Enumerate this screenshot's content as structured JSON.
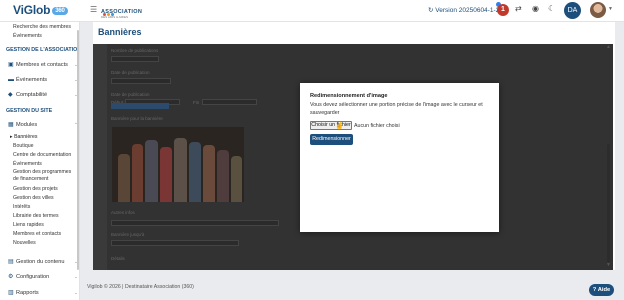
{
  "header": {
    "logo_text": "ViGlob",
    "logo_badge": "360",
    "assoc_title": "ASSOCIATION",
    "assoc_subtitle": "DES AMIS & AMIES",
    "version": "Version 20250604-1-2",
    "notification_count": "1",
    "org_initials": "DA"
  },
  "sidebar": {
    "top_items": [
      "Recherche des membres",
      "Événements"
    ],
    "section_assoc": "GESTION DE L'ASSOCIATION",
    "assoc_items": [
      {
        "label": "Membres et contacts",
        "icon": "people-icon"
      },
      {
        "label": "Événements",
        "icon": "folder-icon"
      },
      {
        "label": "Comptabilité",
        "icon": "money-icon"
      }
    ],
    "section_site": "GESTION DU SITE",
    "site_item": {
      "label": "Modules",
      "icon": "grid-icon"
    },
    "active_sub": "Bannières",
    "module_items": [
      "Boutique",
      "Centre de documentation",
      "Événements",
      "Gestion des programmes de financement",
      "Gestion des projets",
      "Gestion des villes",
      "Intérêts",
      "Librairie des termes",
      "Liens rapides",
      "Membres et contacts",
      "Nouvelles"
    ],
    "bottom_items": [
      {
        "label": "Gestion du contenu",
        "icon": "content-icon"
      },
      {
        "label": "Configuration",
        "icon": "gear-icon"
      },
      {
        "label": "Rapports",
        "icon": "chart-icon"
      }
    ]
  },
  "page": {
    "title": "Bannières"
  },
  "modal": {
    "title": "Redimensionnement d'image",
    "description": "Vous devez sélectionner une portion précise de l'image avec le curseur et sauvegarder",
    "file_button": "Choisir un fichier",
    "file_status": "Aucun fichier choisi",
    "resize_button": "Redimensionner"
  },
  "background_form": {
    "labels": [
      "Nombre de publications",
      "Date de publication",
      "Date de publication",
      "Afficher la bannière",
      "Bannière pour la bannière",
      "Autres infos",
      "Bannière jusqu'à",
      "Détails"
    ],
    "date_label": "Début",
    "date_label_end": "Fin"
  },
  "footer": {
    "text": "Vigilob © 2026 | Destinataire Association (360)",
    "help_button": "Aide"
  }
}
